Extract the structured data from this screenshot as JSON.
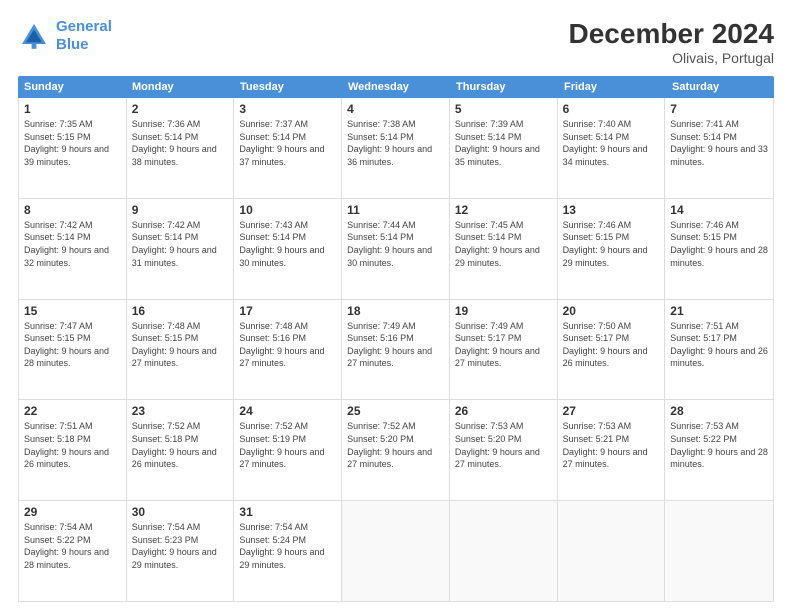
{
  "logo": {
    "line1": "General",
    "line2": "Blue"
  },
  "title": "December 2024",
  "location": "Olivais, Portugal",
  "days_of_week": [
    "Sunday",
    "Monday",
    "Tuesday",
    "Wednesday",
    "Thursday",
    "Friday",
    "Saturday"
  ],
  "weeks": [
    [
      {
        "day": 1,
        "sunrise": "7:35 AM",
        "sunset": "5:15 PM",
        "daylight": "9 hours and 39 minutes."
      },
      {
        "day": 2,
        "sunrise": "7:36 AM",
        "sunset": "5:14 PM",
        "daylight": "9 hours and 38 minutes."
      },
      {
        "day": 3,
        "sunrise": "7:37 AM",
        "sunset": "5:14 PM",
        "daylight": "9 hours and 37 minutes."
      },
      {
        "day": 4,
        "sunrise": "7:38 AM",
        "sunset": "5:14 PM",
        "daylight": "9 hours and 36 minutes."
      },
      {
        "day": 5,
        "sunrise": "7:39 AM",
        "sunset": "5:14 PM",
        "daylight": "9 hours and 35 minutes."
      },
      {
        "day": 6,
        "sunrise": "7:40 AM",
        "sunset": "5:14 PM",
        "daylight": "9 hours and 34 minutes."
      },
      {
        "day": 7,
        "sunrise": "7:41 AM",
        "sunset": "5:14 PM",
        "daylight": "9 hours and 33 minutes."
      }
    ],
    [
      {
        "day": 8,
        "sunrise": "7:42 AM",
        "sunset": "5:14 PM",
        "daylight": "9 hours and 32 minutes."
      },
      {
        "day": 9,
        "sunrise": "7:42 AM",
        "sunset": "5:14 PM",
        "daylight": "9 hours and 31 minutes."
      },
      {
        "day": 10,
        "sunrise": "7:43 AM",
        "sunset": "5:14 PM",
        "daylight": "9 hours and 30 minutes."
      },
      {
        "day": 11,
        "sunrise": "7:44 AM",
        "sunset": "5:14 PM",
        "daylight": "9 hours and 30 minutes."
      },
      {
        "day": 12,
        "sunrise": "7:45 AM",
        "sunset": "5:14 PM",
        "daylight": "9 hours and 29 minutes."
      },
      {
        "day": 13,
        "sunrise": "7:46 AM",
        "sunset": "5:15 PM",
        "daylight": "9 hours and 29 minutes."
      },
      {
        "day": 14,
        "sunrise": "7:46 AM",
        "sunset": "5:15 PM",
        "daylight": "9 hours and 28 minutes."
      }
    ],
    [
      {
        "day": 15,
        "sunrise": "7:47 AM",
        "sunset": "5:15 PM",
        "daylight": "9 hours and 28 minutes."
      },
      {
        "day": 16,
        "sunrise": "7:48 AM",
        "sunset": "5:15 PM",
        "daylight": "9 hours and 27 minutes."
      },
      {
        "day": 17,
        "sunrise": "7:48 AM",
        "sunset": "5:16 PM",
        "daylight": "9 hours and 27 minutes."
      },
      {
        "day": 18,
        "sunrise": "7:49 AM",
        "sunset": "5:16 PM",
        "daylight": "9 hours and 27 minutes."
      },
      {
        "day": 19,
        "sunrise": "7:49 AM",
        "sunset": "5:17 PM",
        "daylight": "9 hours and 27 minutes."
      },
      {
        "day": 20,
        "sunrise": "7:50 AM",
        "sunset": "5:17 PM",
        "daylight": "9 hours and 26 minutes."
      },
      {
        "day": 21,
        "sunrise": "7:51 AM",
        "sunset": "5:17 PM",
        "daylight": "9 hours and 26 minutes."
      }
    ],
    [
      {
        "day": 22,
        "sunrise": "7:51 AM",
        "sunset": "5:18 PM",
        "daylight": "9 hours and 26 minutes."
      },
      {
        "day": 23,
        "sunrise": "7:52 AM",
        "sunset": "5:18 PM",
        "daylight": "9 hours and 26 minutes."
      },
      {
        "day": 24,
        "sunrise": "7:52 AM",
        "sunset": "5:19 PM",
        "daylight": "9 hours and 27 minutes."
      },
      {
        "day": 25,
        "sunrise": "7:52 AM",
        "sunset": "5:20 PM",
        "daylight": "9 hours and 27 minutes."
      },
      {
        "day": 26,
        "sunrise": "7:53 AM",
        "sunset": "5:20 PM",
        "daylight": "9 hours and 27 minutes."
      },
      {
        "day": 27,
        "sunrise": "7:53 AM",
        "sunset": "5:21 PM",
        "daylight": "9 hours and 27 minutes."
      },
      {
        "day": 28,
        "sunrise": "7:53 AM",
        "sunset": "5:22 PM",
        "daylight": "9 hours and 28 minutes."
      }
    ],
    [
      {
        "day": 29,
        "sunrise": "7:54 AM",
        "sunset": "5:22 PM",
        "daylight": "9 hours and 28 minutes."
      },
      {
        "day": 30,
        "sunrise": "7:54 AM",
        "sunset": "5:23 PM",
        "daylight": "9 hours and 29 minutes."
      },
      {
        "day": 31,
        "sunrise": "7:54 AM",
        "sunset": "5:24 PM",
        "daylight": "9 hours and 29 minutes."
      },
      null,
      null,
      null,
      null
    ]
  ]
}
